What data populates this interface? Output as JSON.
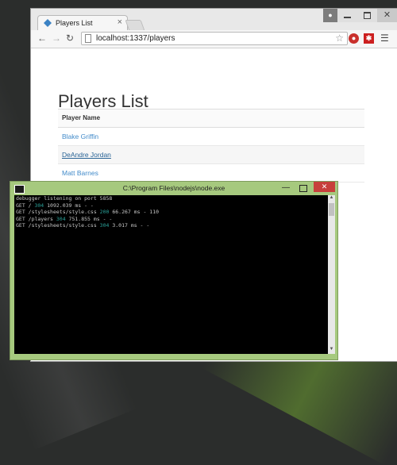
{
  "browser": {
    "tab_title": "Players List",
    "tab_close": "×",
    "user_icon": "user-icon",
    "close_glyph": "✕",
    "url": "localhost:1337/players",
    "ext_badge_1": "⏺",
    "ext_badge_2": "✱"
  },
  "page": {
    "title": "Players List",
    "table": {
      "header": "Player Name",
      "rows": [
        "Blake Griffin",
        "DeAndre Jordan",
        "Matt Barnes"
      ]
    }
  },
  "console": {
    "title": "C:\\Program Files\\nodejs\\node.exe",
    "close_glyph": "✕",
    "lines": [
      {
        "pre": "debugger listening on port 5858",
        "code": "",
        "post": ""
      },
      {
        "pre": "GET / ",
        "code": "304",
        "post": " 1092.039 ms - -"
      },
      {
        "pre": "GET /stylesheets/style.css ",
        "code": "200",
        "post": " 66.267 ms - 110"
      },
      {
        "pre": "GET /players ",
        "code": "304",
        "post": " 751.855 ms - -"
      },
      {
        "pre": "GET /stylesheets/style.css ",
        "code": "304",
        "post": " 3.017 ms - -"
      }
    ]
  },
  "colors": {
    "link": "#428bca",
    "console_green": "#2aa198",
    "console_frame": "#a6c97e",
    "close_red": "#c7403b"
  }
}
